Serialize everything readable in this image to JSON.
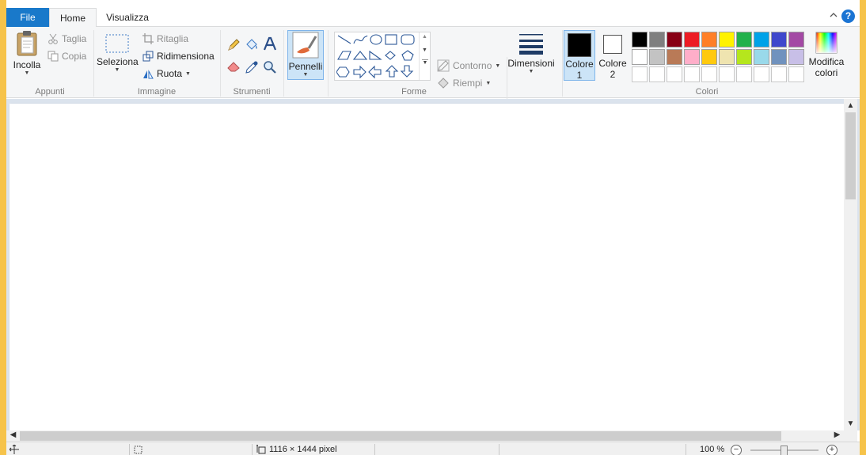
{
  "tabs": {
    "file": "File",
    "home": "Home",
    "view": "Visualizza",
    "collapse_icon": "chevron-up",
    "help_icon": "?"
  },
  "clipboard": {
    "label": "Appunti",
    "paste": "Incolla",
    "cut": "Taglia",
    "copy": "Copia"
  },
  "image": {
    "label": "Immagine",
    "select": "Seleziona",
    "crop": "Ritaglia",
    "resize": "Ridimensiona",
    "rotate": "Ruota"
  },
  "tools": {
    "label": "Strumenti",
    "items": [
      "pencil",
      "fill",
      "text",
      "eraser",
      "color-picker",
      "magnifier"
    ]
  },
  "brushes": {
    "label": "Pennelli"
  },
  "shapes": {
    "label": "Forme",
    "outline": "Contorno",
    "fill": "Riempi"
  },
  "size": {
    "label": "Dimensioni"
  },
  "colors": {
    "label": "Colori",
    "color1": "Colore",
    "color1_num": "1",
    "color2": "Colore",
    "color2_num": "2",
    "edit": "Modifica",
    "edit2": "colori",
    "color1_value": "#000000",
    "color2_value": "#ffffff",
    "palette": [
      "#000000",
      "#7f7f7f",
      "#880015",
      "#ed1c24",
      "#ff7f27",
      "#fff200",
      "#22b14c",
      "#00a2e8",
      "#3f48cc",
      "#a349a4",
      "#ffffff",
      "#c3c3c3",
      "#b97a57",
      "#ffaec9",
      "#ffc90e",
      "#efe4b0",
      "#b5e61d",
      "#99d9ea",
      "#7092be",
      "#c8bfe7"
    ]
  },
  "status": {
    "size": "1116 × 1444 pixel",
    "zoom": "100 %"
  }
}
